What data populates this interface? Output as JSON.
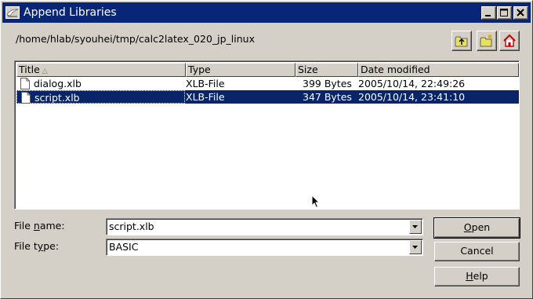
{
  "window": {
    "title": "Append Libraries"
  },
  "path": "/home/hlab/syouhei/tmp/calc2latex_020_jp_linux",
  "toolbar": {
    "icons": [
      "folder-up-icon",
      "new-folder-icon",
      "home-icon"
    ]
  },
  "file_list": {
    "columns": [
      "Title",
      "Type",
      "Size",
      "Date modified"
    ],
    "sort_column": "Title",
    "rows": [
      {
        "name": "dialog.xlb",
        "type": "XLB-File",
        "size": "399 Bytes",
        "date": "2005/10/14, 22:49:26",
        "selected": false
      },
      {
        "name": "script.xlb",
        "type": "XLB-File",
        "size": "347 Bytes",
        "date": "2005/10/14, 23:41:10",
        "selected": true
      }
    ]
  },
  "form": {
    "file_name_label_pre": "File ",
    "file_name_label_u": "n",
    "file_name_label_post": "ame:",
    "file_name_value": "script.xlb",
    "file_type_label_pre": "File t",
    "file_type_label_u": "y",
    "file_type_label_post": "pe:",
    "file_type_value": "BASIC"
  },
  "buttons": {
    "open_u": "O",
    "open_rest": "pen",
    "cancel": "Cancel",
    "help_u": "H",
    "help_rest": "elp"
  },
  "colors": {
    "titlebar": "#082577",
    "selection": "#0a246a",
    "face": "#d4d0c8"
  }
}
